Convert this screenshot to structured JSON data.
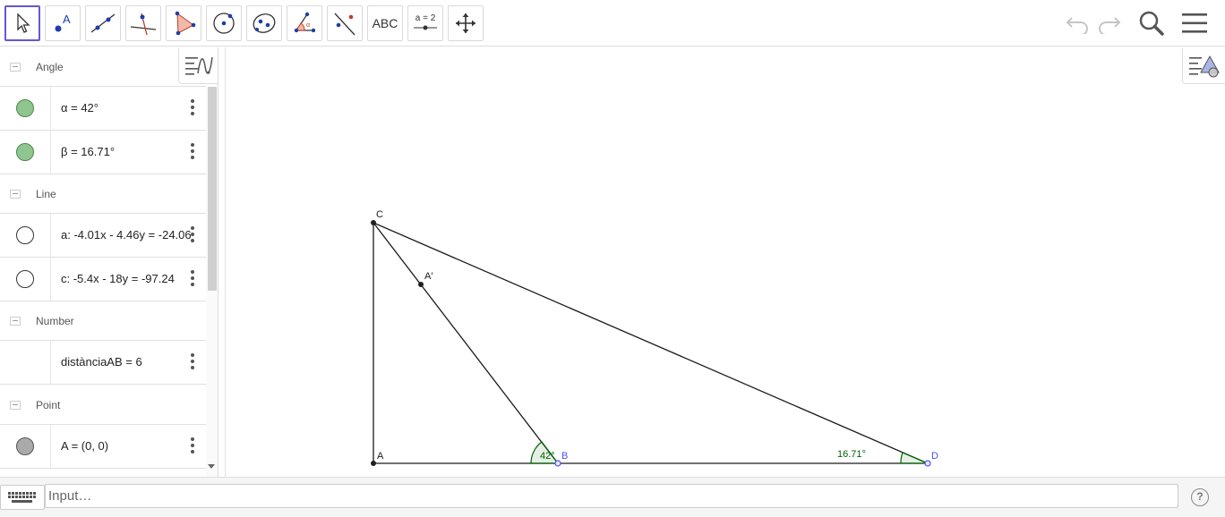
{
  "toolbar": {
    "text_tool_label": "ABC",
    "slider_tool_label": "a = 2"
  },
  "algebra": {
    "groups": [
      {
        "name": "Angle"
      },
      {
        "name": "Line"
      },
      {
        "name": "Number"
      },
      {
        "name": "Point"
      }
    ],
    "rows": [
      {
        "expr": "α = 42°",
        "marble_color": "#8fc58f"
      },
      {
        "expr": "β = 16.71°",
        "marble_color": "#8fc58f"
      },
      {
        "expr": "a: -4.01x - 4.46y = -24.06",
        "marble_color": "#ffffff"
      },
      {
        "expr": "c: -5.4x - 18y = -97.24",
        "marble_color": "#ffffff"
      },
      {
        "expr": "distànciaAB = 6",
        "marble_color": ""
      },
      {
        "expr": "A = (0, 0)",
        "marble_color": "#aaaaaa"
      }
    ]
  },
  "graphics": {
    "labels": {
      "C": "C",
      "A_prime": "A′",
      "A": "A",
      "B": "B",
      "D": "D",
      "angle_alpha": "42°",
      "angle_beta": "16.71°"
    },
    "colors": {
      "angle": "#006400",
      "point_free": "#1f1f1f",
      "point_blue": "#4d4dff"
    }
  },
  "input": {
    "placeholder": "Input…"
  },
  "help_label": "?"
}
